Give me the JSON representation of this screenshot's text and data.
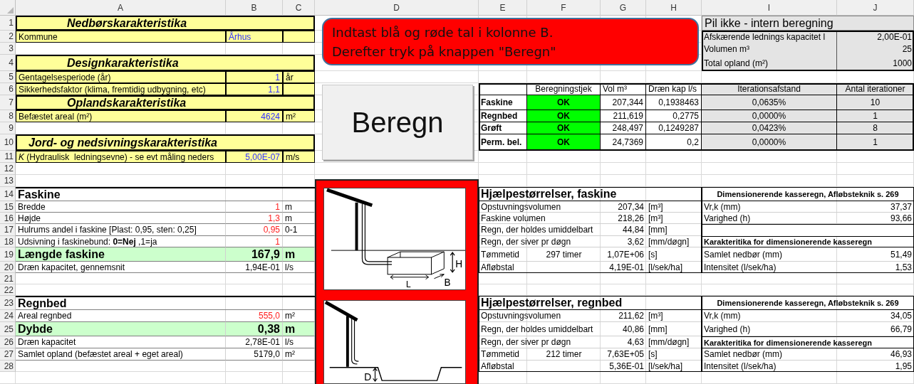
{
  "sheet": {
    "columns": [
      "A",
      "B",
      "C",
      "D",
      "E",
      "F",
      "G",
      "H",
      "I",
      "J"
    ],
    "row_numbers": [
      "1",
      "2",
      "3",
      "4",
      "5",
      "6",
      "7",
      "8",
      "9",
      "10",
      "11",
      "12",
      "13",
      "14",
      "15",
      "16",
      "17",
      "18",
      "19",
      "20",
      "21",
      "22",
      "23",
      "24",
      "25",
      "26",
      "27",
      "28"
    ]
  },
  "inputs": {
    "rows": [
      {
        "kind": "heading",
        "label": "Nedbørskarakteristika"
      },
      {
        "kind": "design_field",
        "label": "Kommune",
        "value": "Århus",
        "color": "#3333ff",
        "text_value": true
      },
      {
        "kind": "blank"
      },
      {
        "kind": "heading",
        "label": "Designkarakteristika"
      },
      {
        "kind": "design_field",
        "label": "Gentagelsesperiode (år)",
        "value": "1",
        "unit": "år",
        "color": "#3333ff"
      },
      {
        "kind": "design_field",
        "label": "Sikkerhedsfaktor (klima, fremtidig udbygning, etc)",
        "value": "1,1",
        "color": "#3333ff"
      },
      {
        "kind": "heading",
        "label": "Oplandskarakteristika"
      },
      {
        "kind": "design_field",
        "label": "Befæstet areal (m²)",
        "value": "4624",
        "unit": "m²",
        "color": "#3333ff"
      },
      {
        "kind": "blank"
      },
      {
        "kind": "heading",
        "label": "Jord- og nedsivningskarakteristika"
      },
      {
        "kind": "design_field",
        "label": "*K* (Hydraulisk  ledningsevne) - se evt måling neders",
        "value": "5,00E-07",
        "unit": "m/s",
        "color": "#3333ff"
      },
      {
        "kind": "blank"
      },
      {
        "kind": "blank"
      },
      {
        "kind": "title",
        "label": "Faskine"
      },
      {
        "kind": "field",
        "label": "Bredde",
        "value": "1",
        "unit": "m",
        "color": "#ff2020"
      },
      {
        "kind": "field",
        "label": "Højde",
        "value": "1,3",
        "unit": "m",
        "color": "#ff2020"
      },
      {
        "kind": "field",
        "label": "Hulrums andel i faskine [Plast: 0,95, sten: 0,25]",
        "value": "0,95",
        "unit": "0-1",
        "color": "#ff2020"
      },
      {
        "kind": "field",
        "label": "Udsivning i faskinebund: **0=Nej** ,1=ja",
        "value": "1",
        "color": "#ff2020"
      },
      {
        "kind": "result",
        "label": "Længde faskine",
        "value": "167,9",
        "unit": "m"
      },
      {
        "kind": "field",
        "label": "Dræn kapacitet, gennemsnit",
        "value": "1,94E-01",
        "unit": "l/s"
      },
      {
        "kind": "blank"
      },
      {
        "kind": "blank"
      },
      {
        "kind": "title",
        "label": "Regnbed"
      },
      {
        "kind": "field",
        "label": "Areal regnbed",
        "value": "555,0",
        "unit": "m²",
        "color": "#ff2020"
      },
      {
        "kind": "result",
        "label": "Dybde",
        "value": "0,38",
        "unit": "m"
      },
      {
        "kind": "field",
        "label": "Dræn kapacitet",
        "value": "2,78E-01",
        "unit": "l/s"
      },
      {
        "kind": "field",
        "label": "Samlet opland (befæstet areal + eget areal)",
        "value": "5179,0",
        "unit": "m²"
      }
    ]
  },
  "instruction": {
    "lines": [
      "Indtast blå og røde tal i kolonne B.",
      "Derefter tryk på knappen \"Beregn\""
    ]
  },
  "calculate_button": {
    "label": "Beregn"
  },
  "illustrations": [
    {
      "kind": "faskine",
      "labels": [
        "H",
        "L",
        "B"
      ]
    },
    {
      "kind": "regnbed",
      "labels": [
        "D"
      ]
    }
  ],
  "internal": {
    "title": "Pil ikke - intern beregning",
    "rows": [
      {
        "label": "Afskærende lednings kapacitet l",
        "value": "2,00E-01"
      },
      {
        "label": "Volumen m³",
        "value": "25"
      },
      {
        "label": "Total opland (m²)",
        "value": "1000"
      }
    ]
  },
  "check_table": {
    "columns": [
      "Beregningstjek",
      "Vol m³",
      "Dræn kap l/s",
      "Iterationsafstand",
      "Antal iterationer"
    ],
    "rows": [
      {
        "name": "Faskine",
        "status": "OK",
        "ok": true,
        "volume": "207,344",
        "drain": "0,1938463",
        "distance": "0,0635%",
        "iterations": "10"
      },
      {
        "name": "Regnbed",
        "status": "OK",
        "ok": true,
        "volume": "211,619",
        "drain": "0,2775",
        "distance": "0,0000%",
        "iterations": "1"
      },
      {
        "name": "Grøft",
        "status": "OK",
        "ok": true,
        "volume": "248,497",
        "drain": "0,1249287",
        "distance": "0,0423%",
        "iterations": "8"
      },
      {
        "name": "Perm. bel.",
        "status": "OK",
        "ok": true,
        "volume": "24,7369",
        "drain": "0,2",
        "distance": "0,0000%",
        "iterations": "1"
      }
    ]
  },
  "helpers": [
    {
      "title": "Hjælpestørrelser, faskine",
      "rows": [
        {
          "label": "Opstuvningsvolumen",
          "value": "207,34",
          "unit": "[m³]"
        },
        {
          "label": "Faskine volumen",
          "value": "218,26",
          "unit": "[m³]"
        },
        {
          "label": "Regn, der holdes umiddelbart",
          "value": "44,84",
          "unit": "[mm]"
        },
        {
          "label": "Regn, der siver pr døgn",
          "value": "3,62",
          "unit": "[mm/døgn]"
        },
        {
          "label": "Tømmetid",
          "note": "297 timer",
          "value": "1,07E+06",
          "unit": "[s]"
        },
        {
          "label": "Afløbstal",
          "value": "4,19E-01",
          "unit": "[l/sek/ha]"
        }
      ],
      "design": {
        "title": "Dimensionerende kasseregn, Afløbsteknik s. 269",
        "rows": [
          {
            "kind": "value",
            "label": "Vr,k (mm)",
            "value": "37,37"
          },
          {
            "kind": "value",
            "label": "Varighed (h)",
            "value": "93,66"
          },
          {
            "kind": "blank"
          },
          {
            "kind": "subheading",
            "label": "Karakteritika for dimensionerende kasseregn"
          },
          {
            "kind": "value",
            "label": "Samlet nedbør (mm)",
            "value": "51,49"
          },
          {
            "kind": "value",
            "label": "Intensitet (l/sek/ha)",
            "value": "1,53"
          }
        ]
      }
    },
    {
      "title": "Hjælpestørrelser, regnbed",
      "rows": [
        {
          "label": "Opstuvningsvolumen",
          "value": "211,62",
          "unit": "[m³]"
        },
        {
          "label": "Regn, der holdes umiddelbart",
          "value": "40,86",
          "unit": "[mm]"
        },
        {
          "label": "Regn, der siver pr døgn",
          "value": "4,63",
          "unit": "[mm/døgn]"
        },
        {
          "label": "Tømmetid",
          "note": "212 timer",
          "value": "7,63E+05",
          "unit": "[s]"
        },
        {
          "label": "Afløbstal",
          "value": "5,36E-01",
          "unit": "[l/sek/ha]"
        }
      ],
      "design": {
        "title": "Dimensionerende kasseregn, Afløbsteknik s. 269",
        "rows": [
          {
            "kind": "value",
            "label": "Vr,k (mm)",
            "value": "34,05"
          },
          {
            "kind": "value",
            "label": "Varighed (h)",
            "value": "66,79"
          },
          {
            "kind": "subheading",
            "label": "Karakteritika for dimensionerende kasseregn"
          },
          {
            "kind": "value",
            "label": "Samlet nedbør (mm)",
            "value": "46,93"
          },
          {
            "kind": "value",
            "label": "Intensitet (l/sek/ha)",
            "value": "1,95"
          }
        ]
      }
    }
  ]
}
